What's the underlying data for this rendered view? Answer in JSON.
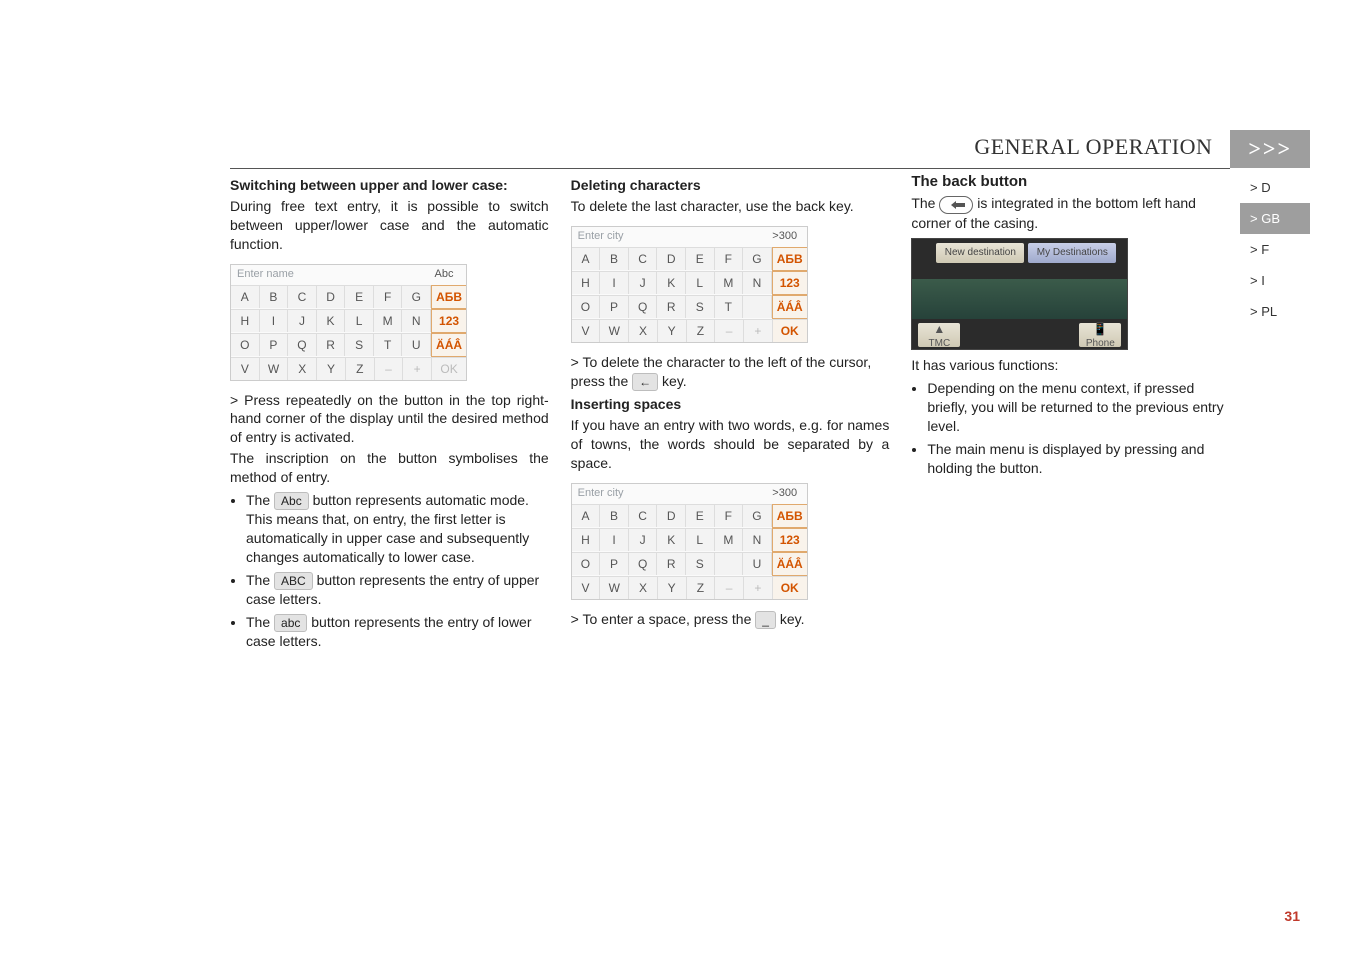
{
  "header": {
    "title": "GENERAL OPERATION",
    "chevrons": ">>>"
  },
  "sidetabs": {
    "d": "> D",
    "gb": "> GB",
    "f": "> F",
    "i": "> I",
    "pl": "> PL"
  },
  "col1": {
    "h4": "Switching between upper and lower case:",
    "p1": "During free text entry, it is possible to switch between upper/lower case and the automatic function.",
    "kbd": {
      "placeholder": "Enter name",
      "rightcap": "Abc",
      "row1": [
        "A",
        "B",
        "C",
        "D",
        "E",
        "F",
        "G",
        "АБВ"
      ],
      "row2": [
        "H",
        "I",
        "J",
        "K",
        "L",
        "M",
        "N",
        "123"
      ],
      "row3": [
        "O",
        "P",
        "Q",
        "R",
        "S",
        "T",
        "U",
        "ÄÁÂ"
      ],
      "row4": [
        "V",
        "W",
        "X",
        "Y",
        "Z",
        "–",
        "+",
        "OK"
      ]
    },
    "li1": "> Press repeatedly on the button in the top right-hand corner of the display until the desired method of entry is activated.",
    "p2": "The inscription on the button symbolises the method of entry.",
    "b1a": "The ",
    "b1key": "Abc",
    "b1b": " button represents automatic mode. This means that, on entry, the first letter is automatically in upper case and subsequently changes automatically to lower case.",
    "b2a": "The ",
    "b2key": "ABC",
    "b2b": " button represents the entry of upper case letters.",
    "b3a": "The ",
    "b3key": "abc",
    "b3b": " button represents the entry of lower case letters."
  },
  "col2": {
    "h4a": "Deleting characters",
    "p1": "To delete the last character, use the back key.",
    "kbd1": {
      "placeholder": "Enter city",
      "rightcap": ">300",
      "row1": [
        "A",
        "B",
        "C",
        "D",
        "E",
        "F",
        "G",
        "АБВ"
      ],
      "row2": [
        "H",
        "I",
        "J",
        "K",
        "L",
        "M",
        "N",
        "123"
      ],
      "row3": [
        "O",
        "P",
        "Q",
        "R",
        "S",
        "T",
        "",
        "ÄÁÂ"
      ],
      "row4": [
        "V",
        "W",
        "X",
        "Y",
        "Z",
        "–",
        "+",
        "OK"
      ]
    },
    "li1a": "> To delete the character to the left of the cursor, press the ",
    "li1key": "←",
    "li1b": " key.",
    "h4b": "Inserting spaces",
    "p2": "If you have an entry with two words, e.g. for names of towns, the words should be separated by a space.",
    "kbd2": {
      "placeholder": "Enter city",
      "rightcap": ">300",
      "row1": [
        "A",
        "B",
        "C",
        "D",
        "E",
        "F",
        "G",
        "АБВ"
      ],
      "row2": [
        "H",
        "I",
        "J",
        "K",
        "L",
        "M",
        "N",
        "123"
      ],
      "row3": [
        "O",
        "P",
        "Q",
        "R",
        "S",
        "",
        "U",
        "ÄÁÂ"
      ],
      "row4": [
        "V",
        "W",
        "X",
        "Y",
        "Z",
        "–",
        "+",
        "OK"
      ]
    },
    "li2a": "> To enter a space, press the ",
    "li2key": "_",
    "li2b": " key."
  },
  "col3": {
    "h3": "The back button",
    "p1a": "The ",
    "p1b": " is integrated in the bottom left hand corner of the casing.",
    "device": {
      "tab_left": "New destination",
      "tab_right": "My Destinations",
      "bottom_left": "TMC",
      "bottom_right": "Phone"
    },
    "p2": "It has various functions:",
    "b1": "Depending on the menu context, if pressed briefly, you will be returned to the previous entry level.",
    "b2": "The main menu is displayed by pressing and holding the button."
  },
  "pagenum": "31"
}
